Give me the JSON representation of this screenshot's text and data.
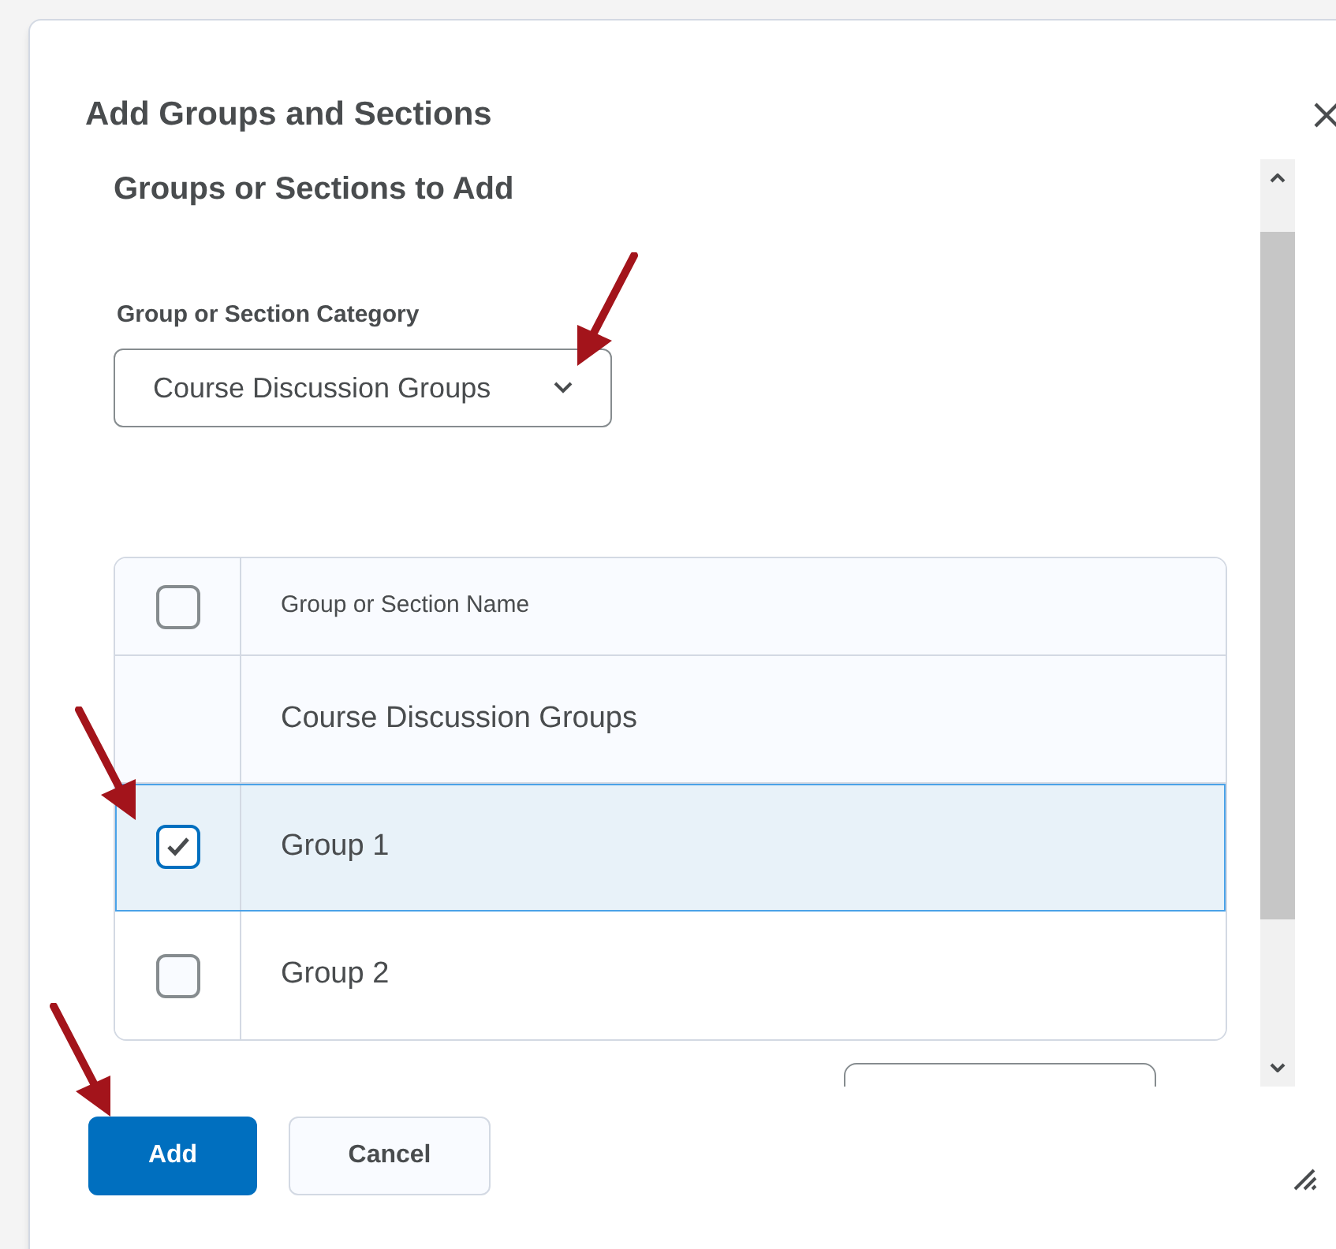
{
  "dialog": {
    "title": "Add Groups and Sections"
  },
  "section": {
    "heading": "Groups or Sections to Add",
    "category_label": "Group or Section Category",
    "category_value": "Course Discussion Groups"
  },
  "table": {
    "header": {
      "label": "Group or Section Name",
      "checked": false
    },
    "rows": [
      {
        "kind": "category",
        "label": "Course Discussion Groups"
      },
      {
        "kind": "item",
        "label": "Group 1",
        "checked": true,
        "selected": true
      },
      {
        "kind": "item",
        "label": "Group 2",
        "checked": false,
        "selected": false
      }
    ]
  },
  "buttons": [
    {
      "label": "Add",
      "kind": "primary"
    },
    {
      "label": "Cancel",
      "kind": "secondary"
    }
  ]
}
